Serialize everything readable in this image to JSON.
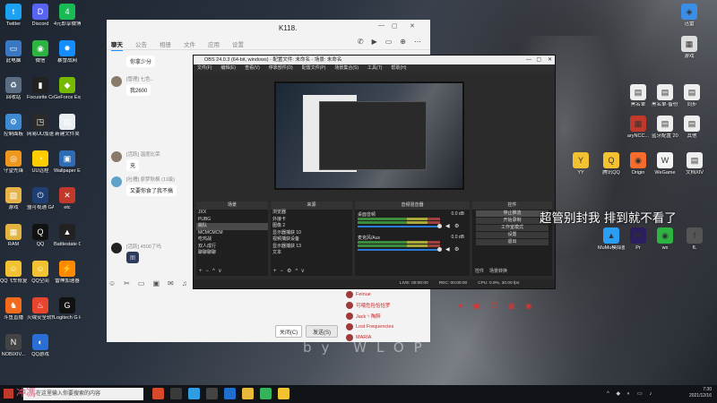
{
  "desktop": {
    "left_icons": [
      {
        "label": "Twitter",
        "color": "#1da1f2",
        "glyph": "t"
      },
      {
        "label": "Discord",
        "color": "#5865f2",
        "glyph": "D"
      },
      {
        "label": "4元即享微博+看热播",
        "color": "#19b955",
        "glyph": "4"
      },
      {
        "label": "此电脑",
        "color": "#3b78c4",
        "glyph": "▭"
      },
      {
        "label": "微信",
        "color": "#2db341",
        "glyph": "◉"
      },
      {
        "label": "暴雪战网",
        "color": "#148eff",
        "glyph": "✸"
      },
      {
        "label": "回收站",
        "color": "#5b6d82",
        "glyph": "♻"
      },
      {
        "label": "Focusrite Control",
        "color": "#222222",
        "glyph": "▮"
      },
      {
        "label": "GeForce Experience",
        "color": "#76b900",
        "glyph": "◆"
      },
      {
        "label": "控制面板",
        "color": "#3f8bd3",
        "glyph": "⚙"
      },
      {
        "label": "网易UU加速器",
        "color": "#2a2a2a",
        "glyph": "◳"
      },
      {
        "label": "新建文件夹",
        "color": "#e9eef2",
        "glyph": "▤"
      },
      {
        "label": "守望先锋",
        "color": "#f0981e",
        "glyph": "◎"
      },
      {
        "label": "UU远程",
        "color": "#ffcc00",
        "glyph": "◔"
      },
      {
        "label": "Wallpaper Engine",
        "color": "#2e6db4",
        "glyph": "▣"
      },
      {
        "label": "游戏",
        "color": "#e6b34a",
        "glyph": "▧"
      },
      {
        "label": "盟可视通 GAME版",
        "color": "#1f3f73",
        "glyph": "⏻"
      },
      {
        "label": "etc",
        "color": "#c0392b",
        "glyph": "✕"
      },
      {
        "label": "RAM",
        "color": "#e3b341",
        "glyph": "▦"
      },
      {
        "label": "QQ",
        "color": "#111111",
        "glyph": "Q"
      },
      {
        "label": "Battlestate Games L...",
        "color": "#222222",
        "glyph": "▲"
      },
      {
        "label": "QQ飞车修复工具",
        "color": "#f3c230",
        "glyph": "☺"
      },
      {
        "label": "QQ空间",
        "color": "#f3c230",
        "glyph": "☺"
      },
      {
        "label": "雷神加速器",
        "color": "#ff8a00",
        "glyph": "⚡"
      },
      {
        "label": "斗鱼直播",
        "color": "#f26b1d",
        "glyph": "♞"
      },
      {
        "label": "火绒安全软件",
        "color": "#e8452e",
        "glyph": "♨"
      },
      {
        "label": "Logitech G HUB",
        "color": "#111111",
        "glyph": "G"
      },
      {
        "label": "NOBIXIV...",
        "color": "#444444",
        "glyph": "N"
      },
      {
        "label": "QQ游戏",
        "color": "#2b6fd6",
        "glyph": "◐"
      }
    ],
    "right_icons": [
      {
        "label": "迅雷",
        "color": "#3a8ee6",
        "glyph": "◈"
      },
      {
        "label": "游戏",
        "color": "#dddddd",
        "glyph": "▦"
      },
      {
        "label": "黑名单",
        "color": "#eeeeee",
        "glyph": "▤"
      },
      {
        "label": "黑名单-备份文件",
        "color": "#eeeeee",
        "glyph": "▤"
      },
      {
        "label": "同步",
        "color": "#eeeeee",
        "glyph": "▤"
      },
      {
        "label": "aryNCC...",
        "color": "#c0392b",
        "glyph": "▦"
      },
      {
        "label": "蓝牙配置 20131118",
        "color": "#eeeeee",
        "glyph": "▤"
      },
      {
        "label": "其他",
        "color": "#eeeeee",
        "glyph": "▤"
      },
      {
        "label": "YY",
        "color": "#f3c230",
        "glyph": "Y"
      },
      {
        "label": "腾讯QQ",
        "color": "#f3c230",
        "glyph": "Q"
      },
      {
        "label": "Origin",
        "color": "#f56c2d",
        "glyph": "◉"
      },
      {
        "label": "WeGame",
        "color": "#f5f5f5",
        "glyph": "W"
      },
      {
        "label": "文档XIV",
        "color": "#eeeeee",
        "glyph": "▤"
      },
      {
        "label": "MuMu模拟器",
        "color": "#2a9df4",
        "glyph": "▲"
      },
      {
        "label": "Pr",
        "color": "#2c1e5e",
        "glyph": "Pr"
      },
      {
        "label": "wx",
        "color": "#2db341",
        "glyph": "◉"
      },
      {
        "label": "fL",
        "color": "#555555",
        "glyph": "f"
      }
    ]
  },
  "qq_window": {
    "title": "K118.",
    "tabs": [
      "聊天",
      "公告",
      "相册",
      "文件",
      "应用",
      "设置"
    ],
    "messages": [
      {
        "name": "",
        "text": "你拿少分"
      },
      {
        "name": "[管理] 七色..",
        "text": "我2600"
      },
      {
        "name": "[活跃] 温度比荣",
        "text": "充"
      },
      {
        "name": "[吐槽] 原梦秋枫 (11级)",
        "text": "又要你食了我不搞"
      },
      {
        "name": "[活跃] 4500了吗",
        "text": "图"
      }
    ],
    "close_label": "关闭(C)",
    "send_label": "发送(S)"
  },
  "obs": {
    "title": "OBS 24.0.3 (64-bit, windows) - 配置文件: 未命名 - 场景: 未命名",
    "menu": [
      "文件(F)",
      "编辑(E)",
      "查看(V)",
      "停靠部件(D)",
      "配置文件(P)",
      "场景集合(S)",
      "工具(T)",
      "帮助(H)"
    ],
    "panels": {
      "scenes_title": "场景",
      "scenes": [
        "JXX",
        "PUBG",
        "踢队",
        "MCMCMCM",
        "吃鸡战",
        "双人成行",
        "聊聊聊聊"
      ],
      "sources_title": "来源",
      "sources": [
        "浏览器",
        "外接卡",
        "图像 2",
        "显示器捕获 10",
        "视频捕获设备",
        "显示器捕获 13",
        "文本"
      ],
      "mixer_title": "音频混音器",
      "mixer": [
        {
          "name": "桌面音频",
          "db": "0.0 dB"
        },
        {
          "name": "麦克风/Aux",
          "db": "0.0 dB"
        }
      ],
      "controls_title": "控件",
      "controls": [
        "停止推流",
        "开始录制",
        "工作室模式",
        "设置",
        "退出"
      ],
      "bottom_tabs": [
        "控件",
        "场景转换"
      ]
    },
    "status": [
      "LIVE: 00:00:00",
      "REC: 00:00:00",
      "CPU: 0.9%, 30.00 fps"
    ]
  },
  "caption": "超管别封我 排到就不看了",
  "live_list": [
    {
      "name": "Feinue"
    },
    {
      "name": "可喂危险恰恰罗"
    },
    {
      "name": "Jack丶陶醉"
    },
    {
      "name": "Lost Frequencies"
    },
    {
      "name": "MARIA"
    }
  ],
  "byline": "by WLOP",
  "taskbar": {
    "search_placeholder": "在这里输入你要搜索的内容",
    "watermark": "冲馮",
    "time": "7:30",
    "date": "2021/12/16",
    "apps": [
      {
        "color": "#d84a2a"
      },
      {
        "color": "#3a3a3a"
      },
      {
        "color": "#2f9ee0"
      },
      {
        "color": "#444444"
      },
      {
        "color": "#1f6fd1"
      },
      {
        "color": "#e8b93a"
      },
      {
        "color": "#35b35a"
      },
      {
        "color": "#f3c230"
      }
    ]
  }
}
